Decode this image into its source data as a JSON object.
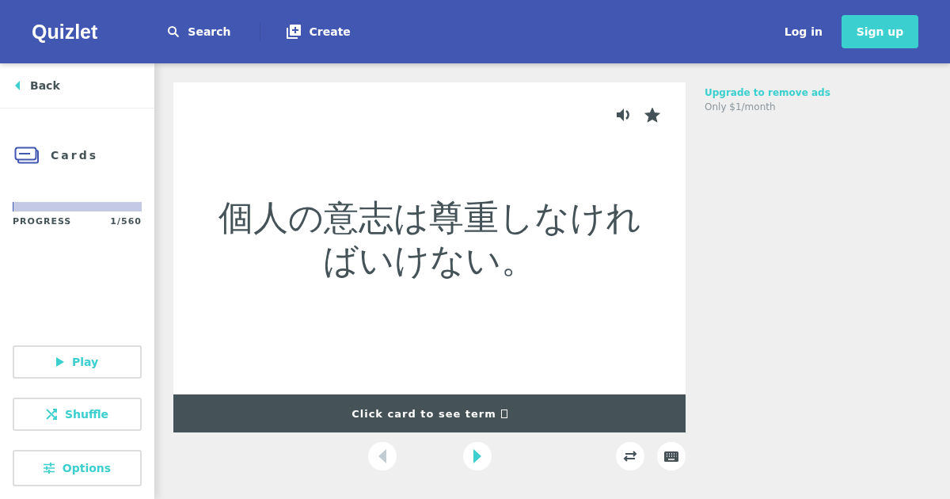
{
  "header": {
    "logo": "Quizlet",
    "nav": [
      {
        "kind": "search",
        "label": "Search"
      },
      {
        "kind": "create",
        "label": "Create"
      }
    ],
    "login": "Log in",
    "signup": "Sign up"
  },
  "sidebar": {
    "back": "Back",
    "mode": "Cards",
    "progress": {
      "label": "PROGRESS",
      "count": "1/560",
      "level": 0.0018
    },
    "buttons": [
      {
        "kind": "play",
        "label": "Play"
      },
      {
        "kind": "shuffle",
        "label": "Shuffle"
      },
      {
        "kind": "options",
        "label": "Options"
      }
    ]
  },
  "card": {
    "text": "個人の意志は尊重しなければいけない。",
    "hint": "Click card to see term",
    "prev_disabled": true,
    "next_disabled": false,
    "starred": true
  },
  "ad": {
    "title": "Upgrade to remove ads",
    "subtitle": "Only $1/month"
  }
}
